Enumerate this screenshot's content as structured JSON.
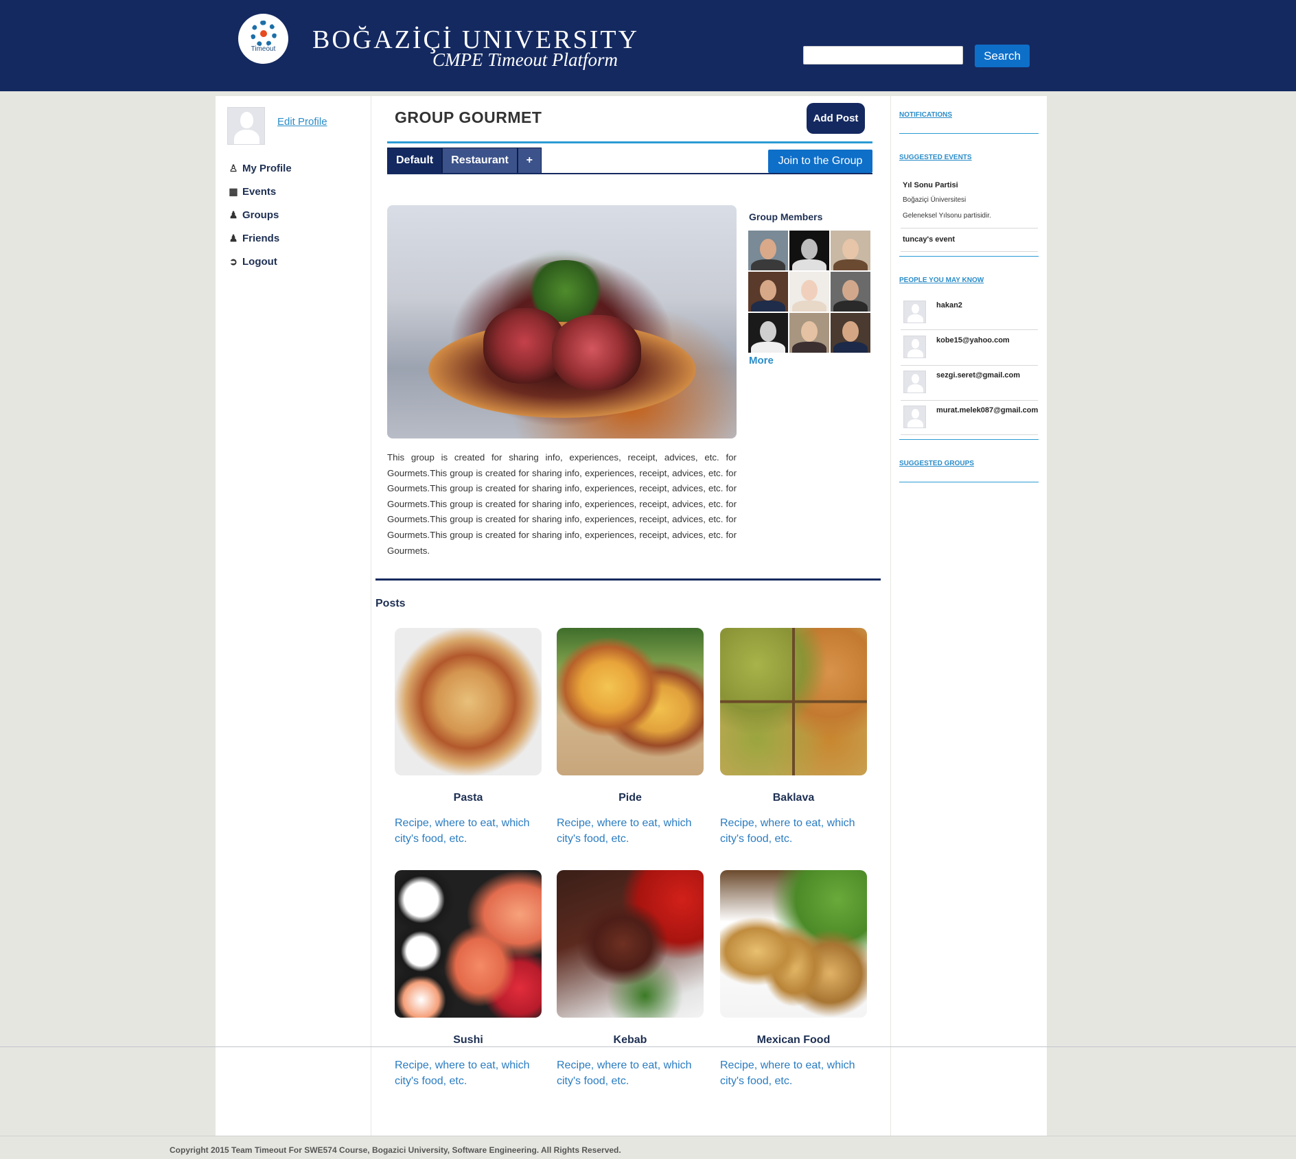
{
  "header": {
    "logo_text": "Timeout",
    "university": "BOĞAZİÇİ UNIVERSITY",
    "platform": "CMPE Timeout Platform",
    "search_value": "",
    "search_button": "Search"
  },
  "sidebar": {
    "edit_profile": "Edit Profile",
    "items": [
      {
        "label": "My Profile",
        "icon": "user-icon"
      },
      {
        "label": "Events",
        "icon": "calendar-icon"
      },
      {
        "label": "Groups",
        "icon": "group-icon"
      },
      {
        "label": "Friends",
        "icon": "friends-icon"
      },
      {
        "label": "Logout",
        "icon": "logout-icon"
      }
    ]
  },
  "group": {
    "title": "GROUP GOURMET",
    "add_post": "Add Post",
    "tabs": [
      "Default",
      "Restaurant",
      "+"
    ],
    "join_button": "Join to the Group",
    "members_title": "Group Members",
    "more_link": "More",
    "description": "This group is created for sharing info, experiences, receipt, advices, etc. for Gourmets.This group is created for sharing info, experiences, receipt, advices, etc. for Gourmets.This group is created for sharing info, experiences, receipt, advices, etc. for Gourmets.This group is created for sharing info, experiences, receipt, advices, etc. for Gourmets.This group is created for sharing info, experiences, receipt, advices, etc. for Gourmets.This group is created for sharing info, experiences, receipt, advices, etc. for Gourmets."
  },
  "posts": {
    "title": "Posts",
    "items": [
      {
        "title": "Pasta",
        "desc": "Recipe, where to eat, which city's food, etc."
      },
      {
        "title": "Pide",
        "desc": "Recipe, where to eat, which city's food, etc."
      },
      {
        "title": "Baklava",
        "desc": "Recipe, where to eat, which city's food, etc."
      },
      {
        "title": "Sushi",
        "desc": "Recipe, where to eat, which city's food, etc."
      },
      {
        "title": "Kebab",
        "desc": "Recipe, where to eat, which city's food, etc."
      },
      {
        "title": "Mexican Food",
        "desc": "Recipe, where to eat, which city's food, etc."
      }
    ]
  },
  "right": {
    "notifications": "NOTIFICATIONS",
    "suggested_events": "SUGGESTED EVENTS",
    "events": [
      {
        "title": "Yıl Sonu Partisi",
        "place": "Boğaziçi Üniversitesi",
        "desc": "Geleneksel Yılsonu partisidir."
      },
      {
        "title": "tuncay's event"
      }
    ],
    "people_title": "PEOPLE YOU MAY KNOW",
    "people": [
      "hakan2",
      "kobe15@yahoo.com",
      "sezgi.seret@gmail.com",
      "murat.melek087@gmail.com"
    ],
    "suggested_groups": "SUGGESTED GROUPS"
  },
  "footer": {
    "text": "Copyright 2015 Team Timeout For SWE574 Course, Bogazici University, Software Engineering. All Rights Reserved."
  },
  "colors": {
    "header_bg": "#142960",
    "accent_blue": "#0e6fc9",
    "link_blue": "#2a8cc8",
    "line_blue": "#2a9bd5"
  }
}
